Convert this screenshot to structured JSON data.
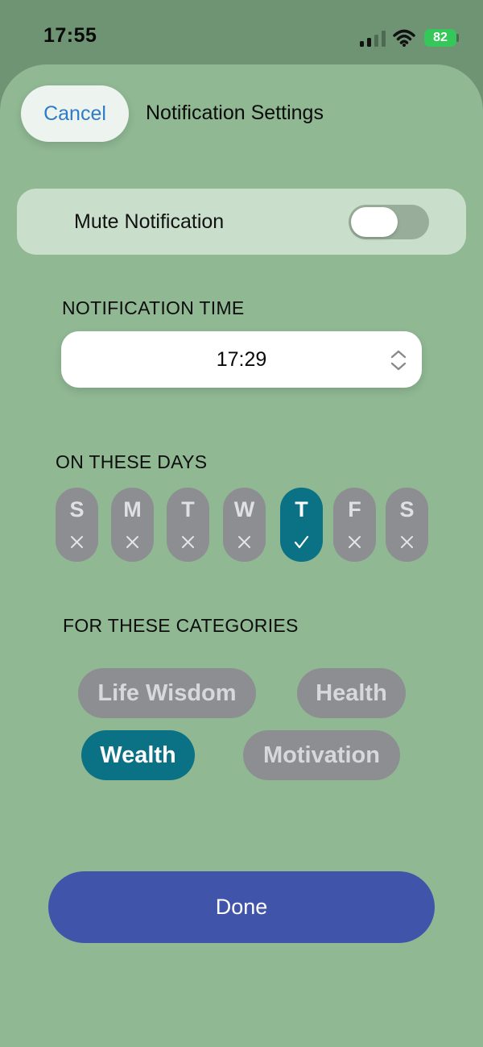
{
  "status_bar": {
    "time": "17:55",
    "battery_level": "82",
    "signal_icon": "cellular-signal-icon",
    "wifi_icon": "wifi-icon",
    "battery_color": "#35c759"
  },
  "header": {
    "cancel_label": "Cancel",
    "title": "Notification Settings"
  },
  "mute": {
    "label": "Mute Notification",
    "enabled": false
  },
  "time_section": {
    "heading": "NOTIFICATION TIME",
    "value": "17:29",
    "stepper_icon": "chevron-up-down-icon"
  },
  "days_section": {
    "heading": "ON THESE DAYS",
    "days": [
      {
        "letter": "S",
        "selected": false
      },
      {
        "letter": "M",
        "selected": false
      },
      {
        "letter": "T",
        "selected": false
      },
      {
        "letter": "W",
        "selected": false
      },
      {
        "letter": "T",
        "selected": true
      },
      {
        "letter": "F",
        "selected": false
      },
      {
        "letter": "S",
        "selected": false
      }
    ],
    "selected_icon": "checkmark-icon",
    "unselected_icon": "cross-icon"
  },
  "categories_section": {
    "heading": "FOR THESE CATEGORIES",
    "items": [
      {
        "label": "Life Wisdom",
        "selected": false
      },
      {
        "label": "Health",
        "selected": false
      },
      {
        "label": "Wealth",
        "selected": true
      },
      {
        "label": "Motivation",
        "selected": false
      }
    ]
  },
  "done_label": "Done",
  "colors": {
    "sheet_background": "#8fb893",
    "accent_teal": "#0b7185",
    "unselected_gray": "#8d8e92",
    "done_button": "#4055a9",
    "cancel_text": "#2e7cc8"
  }
}
